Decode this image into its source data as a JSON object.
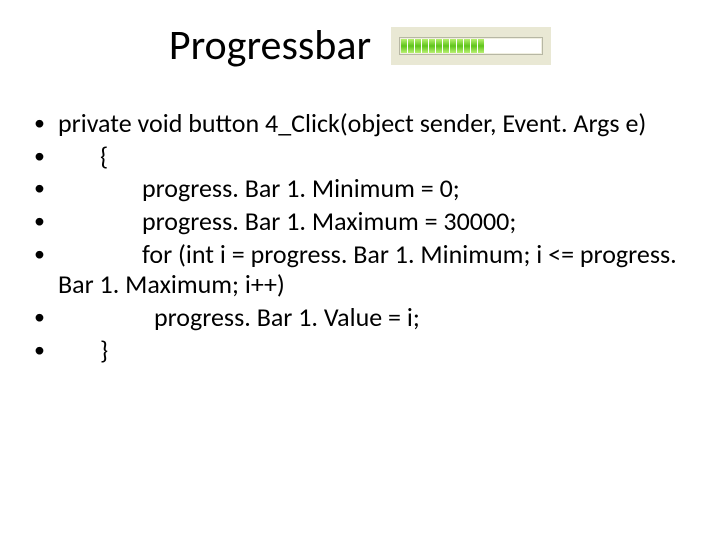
{
  "title": "Progressbar",
  "progressbar": {
    "segments_total": 20,
    "segments_filled": 12,
    "fill_color": "#5fc51b",
    "track_color": "#ffffff",
    "widget_bg": "#e9e8d4"
  },
  "bullets": [
    {
      "text": "private void button 4_Click(object sender, Event. Args e)"
    },
    {
      "text": "{"
    },
    {
      "text": "progress. Bar 1. Minimum = 0;"
    },
    {
      "text": "progress. Bar 1. Maximum = 30000;"
    },
    {
      "text": "for (int i = progress. Bar 1. Minimum; i <= progress. Bar 1. Maximum; i++)"
    },
    {
      "text": "progress. Bar 1. Value = i;"
    },
    {
      "text": "}"
    }
  ]
}
